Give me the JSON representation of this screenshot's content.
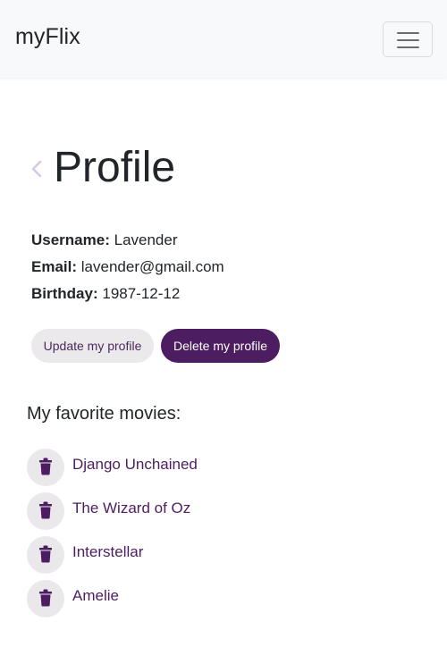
{
  "navbar": {
    "brand": "myFlix",
    "toggler_icon": "hamburger-icon"
  },
  "header": {
    "back_icon": "chevron-left-icon",
    "title": "Profile"
  },
  "profile": {
    "username_label": "Username:",
    "username_value": "Lavender",
    "email_label": "Email:",
    "email_value": "lavender@gmail.com",
    "birthday_label": "Birthday:",
    "birthday_value": "1987-12-12"
  },
  "actions": {
    "update_label": "Update my profile",
    "delete_label": "Delete my profile"
  },
  "favorites": {
    "heading": "My favorite movies:",
    "remove_icon": "trash-icon",
    "movies": [
      {
        "title": "Django Unchained"
      },
      {
        "title": "The Wizard of Oz"
      },
      {
        "title": "Interstellar"
      },
      {
        "title": "Amelie"
      }
    ]
  },
  "colors": {
    "accent": "#4d1d61",
    "accent_light": "#d9c6e6",
    "button_light": "#ece9ec",
    "navbar_bg": "#f8f9fa"
  }
}
